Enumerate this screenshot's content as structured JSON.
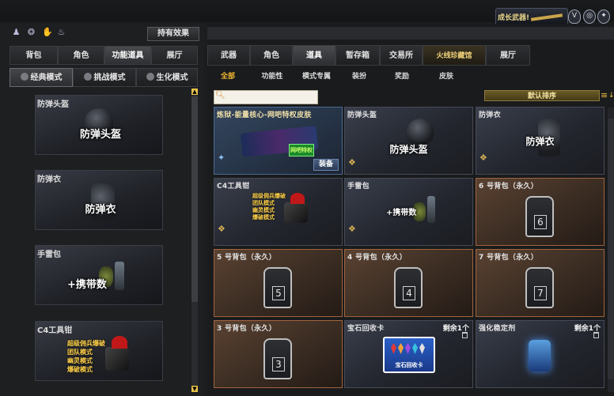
{
  "topbar": {
    "growth_label": "成长武器!",
    "icons": [
      "shield-badge-icon",
      "ring-badge-icon",
      "emblem-icon"
    ]
  },
  "left": {
    "hold_effect_button": "持有效果",
    "small_icons": [
      "figures-icon",
      "swirl-icon",
      "hand-icon",
      "bag-icon"
    ],
    "tabs": [
      {
        "label": "背包"
      },
      {
        "label": "角色"
      },
      {
        "label": "功能道具"
      },
      {
        "label": "展厅"
      }
    ],
    "modes": [
      {
        "label": "经典模式"
      },
      {
        "label": "挑战模式"
      },
      {
        "label": "生化模式"
      }
    ],
    "cards": [
      {
        "title": "防弹头盔",
        "art_label": "防弹头盔"
      },
      {
        "title": "防弹衣",
        "art_label": "防弹衣"
      },
      {
        "title": "手雷包",
        "art_label": "+携带数"
      },
      {
        "title": "C4工具钳",
        "art_lines": [
          "超级佣兵爆破",
          "团队模式",
          "幽灵模式",
          "爆破模式"
        ]
      }
    ]
  },
  "right": {
    "tabs": [
      {
        "label": "武器"
      },
      {
        "label": "角色"
      },
      {
        "label": "道具"
      },
      {
        "label": "暂存箱"
      },
      {
        "label": "交易所"
      },
      {
        "label": "火线珍藏馆"
      },
      {
        "label": "展厅"
      }
    ],
    "subtabs": [
      {
        "label": "全部"
      },
      {
        "label": "功能性"
      },
      {
        "label": "模式专属"
      },
      {
        "label": "装扮"
      },
      {
        "label": "奖励"
      },
      {
        "label": "皮肤"
      }
    ],
    "search_placeholder": "",
    "sort_label": "默认排序",
    "cards": [
      {
        "title": "炼狱-能量核心-网吧特权皮肤",
        "equip_label": "装备",
        "badge": "网吧特权"
      },
      {
        "title": "防弹头盔",
        "art_label": "防弹头盔"
      },
      {
        "title": "防弹衣",
        "art_label": "防弹衣"
      },
      {
        "title": "C4工具钳",
        "art_lines": [
          "超级佣兵爆破",
          "团队模式",
          "幽灵模式",
          "爆破模式"
        ]
      },
      {
        "title": "手雷包",
        "art_label": "+携带数"
      },
      {
        "title": "6 号背包（永久）",
        "num": "6"
      },
      {
        "title": "5 号背包（永久）",
        "num": "5"
      },
      {
        "title": "4 号背包（永久）",
        "num": "4"
      },
      {
        "title": "7 号背包（永久）",
        "num": "7"
      },
      {
        "title": "3 号背包（永久）",
        "num": "3"
      },
      {
        "title": "宝石回收卡",
        "remain": "剩余1个",
        "card_label": "宝石回收卡"
      },
      {
        "title": "强化稳定剂",
        "remain": "剩余1个"
      }
    ]
  }
}
